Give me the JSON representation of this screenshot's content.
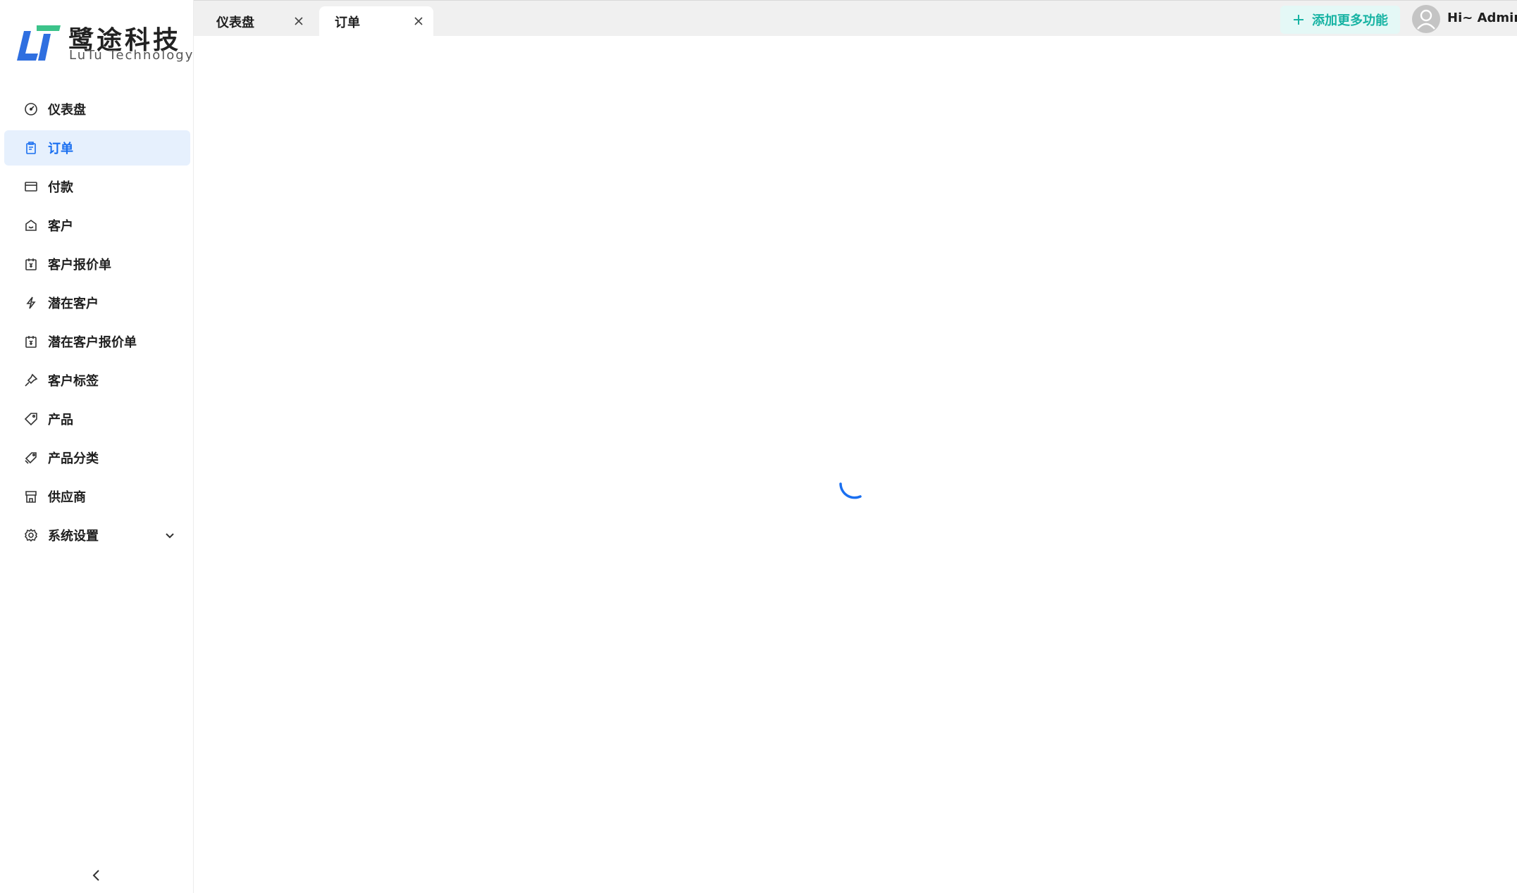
{
  "brand": {
    "name_cn": "鹭途科技",
    "name_en": "LuTu Technology",
    "colors": {
      "blue": "#2f6fe0",
      "green": "#3cc38a"
    }
  },
  "sidebar": {
    "items": [
      {
        "label": "仪表盘",
        "icon": "dashboard-icon",
        "active": false
      },
      {
        "label": "订单",
        "icon": "order-icon",
        "active": true
      },
      {
        "label": "付款",
        "icon": "payment-icon",
        "active": false
      },
      {
        "label": "客户",
        "icon": "customer-icon",
        "active": false
      },
      {
        "label": "客户报价单",
        "icon": "quote-icon",
        "active": false
      },
      {
        "label": "潜在客户",
        "icon": "lightning-icon",
        "active": false
      },
      {
        "label": "潜在客户报价单",
        "icon": "quote-icon",
        "active": false
      },
      {
        "label": "客户标签",
        "icon": "pin-icon",
        "active": false
      },
      {
        "label": "产品",
        "icon": "tag-icon",
        "active": false
      },
      {
        "label": "产品分类",
        "icon": "tags-icon",
        "active": false
      },
      {
        "label": "供应商",
        "icon": "store-icon",
        "active": false
      },
      {
        "label": "系统设置",
        "icon": "gear-icon",
        "active": false,
        "expandable": true
      }
    ],
    "collapse_icon": "chevron-left-icon"
  },
  "tabs": [
    {
      "label": "仪表盘",
      "active": false
    },
    {
      "label": "订单",
      "active": true
    }
  ],
  "header": {
    "add_feature_label": "添加更多功能",
    "user_greeting": "Hi~ Admin"
  },
  "colors": {
    "accent": "#1a6ff0",
    "active_bg": "#e6f0fd",
    "teal": "#17b3a3",
    "teal_bg": "#e4f8f6"
  },
  "main": {
    "state": "loading"
  }
}
